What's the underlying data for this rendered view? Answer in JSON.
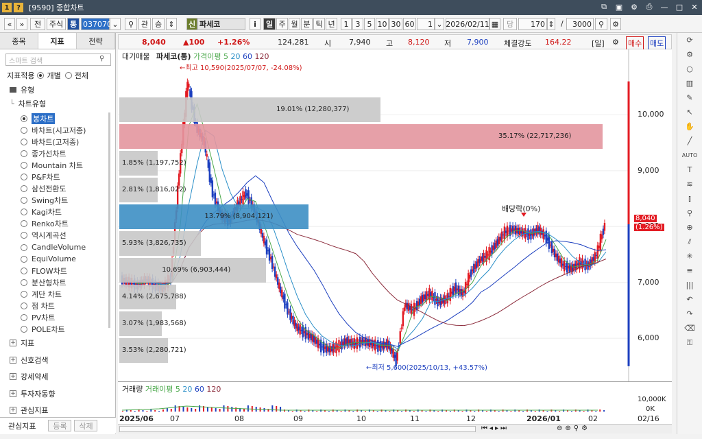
{
  "window": {
    "badge": "1",
    "help": "?",
    "title": "[9590] 종합차트"
  },
  "toolbar": {
    "nav_back": "«",
    "nav_down": "»",
    "jeon": "전",
    "market": "주식",
    "tong": "통",
    "code": "037070",
    "companion": "관",
    "companion2": "승",
    "stock_badge": "신",
    "stock_name": "파세코",
    "info_btn": "i",
    "periods": [
      "일",
      "주",
      "월",
      "분",
      "틱",
      "년"
    ],
    "active_period": "일",
    "nums": [
      "1",
      "3",
      "5",
      "10",
      "30",
      "60"
    ],
    "step": "1",
    "date": "2026/02/11",
    "dang": "당",
    "count": "170",
    "slash": "/",
    "total": "3000"
  },
  "left_panel": {
    "tabs": [
      "종목",
      "지표",
      "전략"
    ],
    "active_tab": "지표",
    "search_placeholder": "스마트 검색",
    "apply_label": "지표적용",
    "apply_opt1": "개별",
    "apply_opt2": "전체",
    "type_header": "유형",
    "chart_type_header": "차트유형",
    "chart_types": [
      "봉차트",
      "바차트(시고저종)",
      "바차트(고저종)",
      "종가선차트",
      "Mountain 차트",
      "P&F차트",
      "삼선전환도",
      "Swing차트",
      "Kagi차트",
      "Renko차트",
      "역시계곡선",
      "CandleVolume",
      "EquiVolume",
      "FLOW차트",
      "분산형차트",
      "계단 차트",
      "점 차트",
      "PV차트",
      "POLE차트"
    ],
    "groups": [
      "지표",
      "신호검색",
      "강세약세",
      "투자자동향",
      "관심지표"
    ],
    "bottom_label": "관심지표",
    "bottom_btn1": "등록",
    "bottom_btn2": "삭제"
  },
  "info_bar": {
    "price": "8,040",
    "change": "▲100",
    "pct": "+1.26%",
    "volume": "124,281",
    "open_label": "시",
    "open": "7,940",
    "high_label": "고",
    "high": "8,120",
    "low_label": "저",
    "low": "7,900",
    "strength_label": "체결강도",
    "strength": "164.22",
    "mode": "[일]",
    "buy": "매수",
    "sell": "매도"
  },
  "chart": {
    "legend": {
      "overlay": "대기매물",
      "name": "파세코(통)",
      "ma_label": "가격이평 5",
      "ma20": "20",
      "ma60": "60",
      "ma120": "120"
    },
    "high_note": "←최고 10,590(2025/07/07, -24.08%)",
    "low_note": "←최저 5,600(2025/10/13, +43.57%)",
    "dividend_note": "배당락(0%)",
    "price_ticks": [
      "10,000",
      "9,000",
      "8,000",
      "7,000",
      "6,000"
    ],
    "current_price": "8,040",
    "current_pct": "(1.26%)",
    "profile": [
      {
        "label": "19.01% (12,280,377)",
        "pct": 19.01,
        "color": "#c8c8c8"
      },
      {
        "label": "35.17% (22,717,236)",
        "pct": 35.17,
        "color": "#e3969f"
      },
      {
        "label": "1.85% (1,197,752)",
        "pct": 1.85,
        "color": "#c8c8c8"
      },
      {
        "label": "2.81% (1,816,022)",
        "pct": 2.81,
        "color": "#c8c8c8"
      },
      {
        "label": "13.79% (8,904,121)",
        "pct": 13.79,
        "color": "#3d8fc4"
      },
      {
        "label": "5.93% (3,826,735)",
        "pct": 5.93,
        "color": "#c8c8c8"
      },
      {
        "label": "10.69% (6,903,444)",
        "pct": 10.69,
        "color": "#c8c8c8"
      },
      {
        "label": "4.14% (2,675,788)",
        "pct": 4.14,
        "color": "#c8c8c8"
      },
      {
        "label": "3.07% (1,983,568)",
        "pct": 3.07,
        "color": "#c8c8c8"
      },
      {
        "label": "3.53% (2,280,721)",
        "pct": 3.53,
        "color": "#c8c8c8"
      }
    ],
    "vol_legend": {
      "name": "거래량",
      "ma_label": "거래이평 5",
      "ma20": "20",
      "ma60": "60",
      "ma120": "120"
    },
    "vol_tick": "10,000K",
    "vol_tick2": "0K",
    "x_ticks": [
      "2025/06",
      "07",
      "08",
      "09",
      "10",
      "11",
      "12",
      "2026/01",
      "02"
    ],
    "x_end": "02/16"
  },
  "chart_data": {
    "type": "candlestick",
    "ylim": [
      5400,
      11000
    ],
    "price_ticks": [
      10000,
      9000,
      8000,
      7000,
      6000
    ],
    "close_path": [
      7050,
      7000,
      6950,
      7050,
      6950,
      6900,
      7100,
      9000,
      10590,
      9800,
      9500,
      8600,
      8200,
      8100,
      8400,
      8600,
      8300,
      7800,
      7400,
      6900,
      6500,
      6200,
      6100,
      6000,
      5850,
      5800,
      5850,
      5950,
      5900,
      5950,
      5900,
      5850,
      5900,
      5600,
      6600,
      6500,
      6700,
      6800,
      6650,
      6700,
      6900,
      6800,
      7200,
      7400,
      7500,
      7700,
      7900,
      7950,
      7900,
      7850,
      7950,
      7800,
      7500,
      7300,
      7250,
      7350,
      7300,
      7500,
      8040
    ],
    "high": 10590,
    "low": 5600,
    "current": 8040
  }
}
